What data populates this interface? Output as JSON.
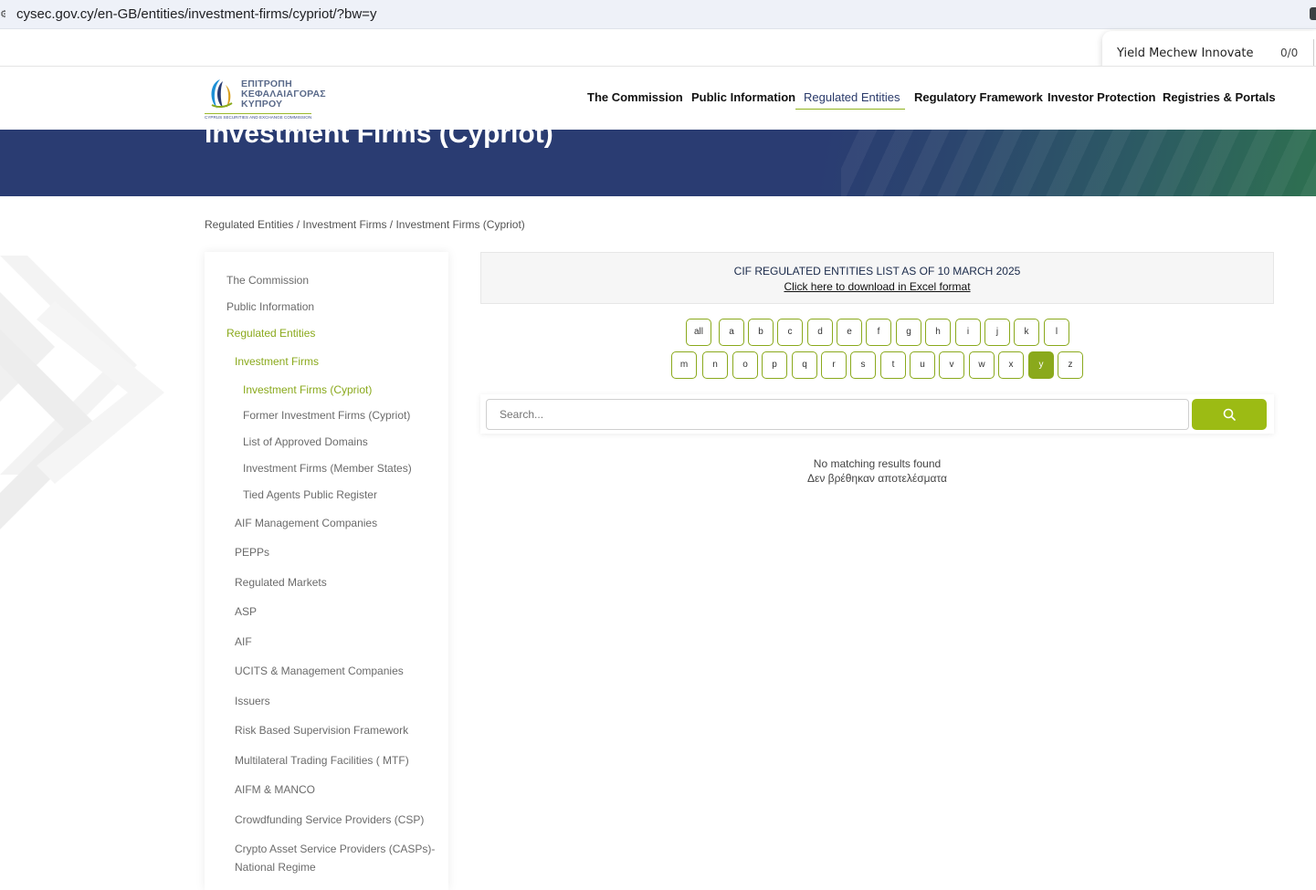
{
  "browser": {
    "url": "cysec.gov.cy/en-GB/entities/investment-firms/cypriot/?bw=y",
    "find_query": "Yield Mechew Innovate",
    "find_count": "0/0"
  },
  "logo": {
    "greek_lines": [
      "ΕΠΙΤΡΟΠΗ",
      "ΚΕΦΑΛΑΙΑΓΟΡΑΣ",
      "ΚΥΠΡΟΥ"
    ],
    "english_line": "CYPRUS SECURITIES AND EXCHANGE COMMISSION"
  },
  "nav": {
    "items": [
      {
        "label": "The Commission"
      },
      {
        "label": "Public Information"
      },
      {
        "label": "Regulated Entities"
      },
      {
        "label": "Regulatory Framework"
      },
      {
        "label": "Investor Protection"
      },
      {
        "label": "Registries & Portals"
      }
    ],
    "active_index": 2
  },
  "hero": {
    "title": "Investment Firms (Cypriot)"
  },
  "breadcrumb": {
    "parts": [
      "Regulated Entities",
      "Investment Firms",
      "Investment Firms (Cypriot)"
    ],
    "separator": " / "
  },
  "sidebar": {
    "items": [
      {
        "label": "The Commission"
      },
      {
        "label": "Public Information"
      },
      {
        "label": "Regulated Entities"
      },
      {
        "label": "Investment Firms"
      },
      {
        "label": "Investment Firms (Cypriot)"
      },
      {
        "label": "Former Investment Firms (Cypriot)"
      },
      {
        "label": "List of Approved Domains"
      },
      {
        "label": "Investment Firms (Member States)"
      },
      {
        "label": "Tied Agents Public Register"
      },
      {
        "label": "AIF Management Companies"
      },
      {
        "label": "PEPPs"
      },
      {
        "label": "Regulated Markets"
      },
      {
        "label": "ASP"
      },
      {
        "label": "AIF"
      },
      {
        "label": "UCITS & Management Companies"
      },
      {
        "label": "Issuers"
      },
      {
        "label": "Risk Based Supervision Framework"
      },
      {
        "label": "Multilateral Trading Facilities ( MTF)"
      },
      {
        "label": "AIFM & MANCO"
      },
      {
        "label": "Crowdfunding Service Providers (CSP)"
      },
      {
        "label": "Crypto Asset Service Providers (CASPs)-National Regime"
      }
    ]
  },
  "notice": {
    "title": "CIF REGULATED ENTITIES LIST AS OF 10 MARCH 2025",
    "link": "Click here to download in Excel format"
  },
  "letters": {
    "row1": [
      "all",
      "a",
      "b",
      "c",
      "d",
      "e",
      "f",
      "g",
      "h",
      "i",
      "j",
      "k",
      "l"
    ],
    "row2": [
      "m",
      "n",
      "o",
      "p",
      "q",
      "r",
      "s",
      "t",
      "u",
      "v",
      "w",
      "x",
      "y",
      "z"
    ],
    "selected": "y"
  },
  "search": {
    "placeholder": "Search..."
  },
  "results": {
    "empty_en": "No matching results found",
    "empty_el": "Δεν βρέθηκαν αποτελέσματα"
  },
  "colors": {
    "accent_green": "#8aa91c",
    "hero_navy": "#2a3c72",
    "search_button": "#9cbb14"
  }
}
